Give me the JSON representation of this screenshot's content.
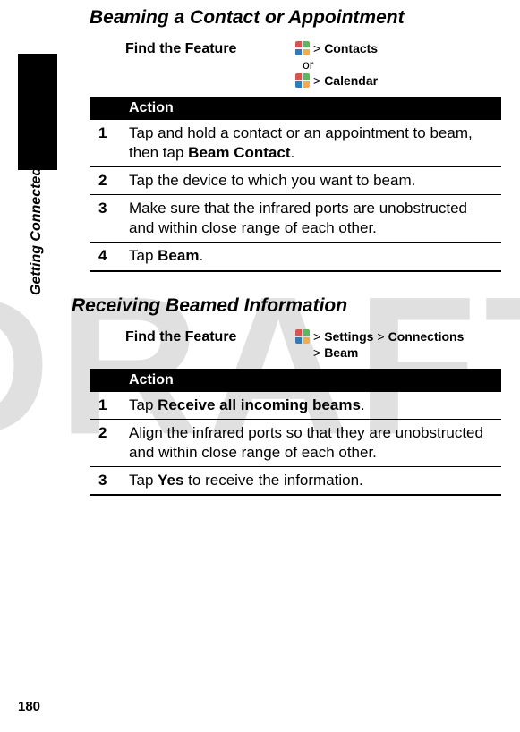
{
  "watermark": "DRAFT",
  "side_label": "Getting Connected",
  "page_number": "180",
  "section1": {
    "title": "Beaming a Contact or Appointment",
    "find_label": "Find the Feature",
    "path1_prefix": ">",
    "path1_item": "Contacts",
    "or": "or",
    "path2_prefix": ">",
    "path2_item": "Calendar",
    "action_header": "Action",
    "steps": [
      {
        "n": "1",
        "pre": "Tap and hold a contact or an appointment to beam, then tap ",
        "bold": "Beam Contact",
        "post": "."
      },
      {
        "n": "2",
        "pre": "Tap the device to which you want to beam.",
        "bold": "",
        "post": ""
      },
      {
        "n": "3",
        "pre": "Make sure that the infrared ports are unobstructed and within close range of each other.",
        "bold": "",
        "post": ""
      },
      {
        "n": "4",
        "pre": "Tap ",
        "bold": "Beam",
        "post": "."
      }
    ]
  },
  "section2": {
    "title": "Receiving Beamed Information",
    "find_label": "Find the Feature",
    "path_gt1": ">",
    "path_settings": "Settings",
    "path_gt2": ">",
    "path_connections": "Connections",
    "path_gt3": ">",
    "path_beam": "Beam",
    "action_header": "Action",
    "steps": [
      {
        "n": "1",
        "pre": "Tap ",
        "bold": "Receive all incoming beams",
        "post": "."
      },
      {
        "n": "2",
        "pre": "Align the infrared ports so that they are unobstructed and within close range of each other.",
        "bold": "",
        "post": ""
      },
      {
        "n": "3",
        "pre": "Tap ",
        "bold": "Yes",
        "post": " to receive the information."
      }
    ]
  }
}
